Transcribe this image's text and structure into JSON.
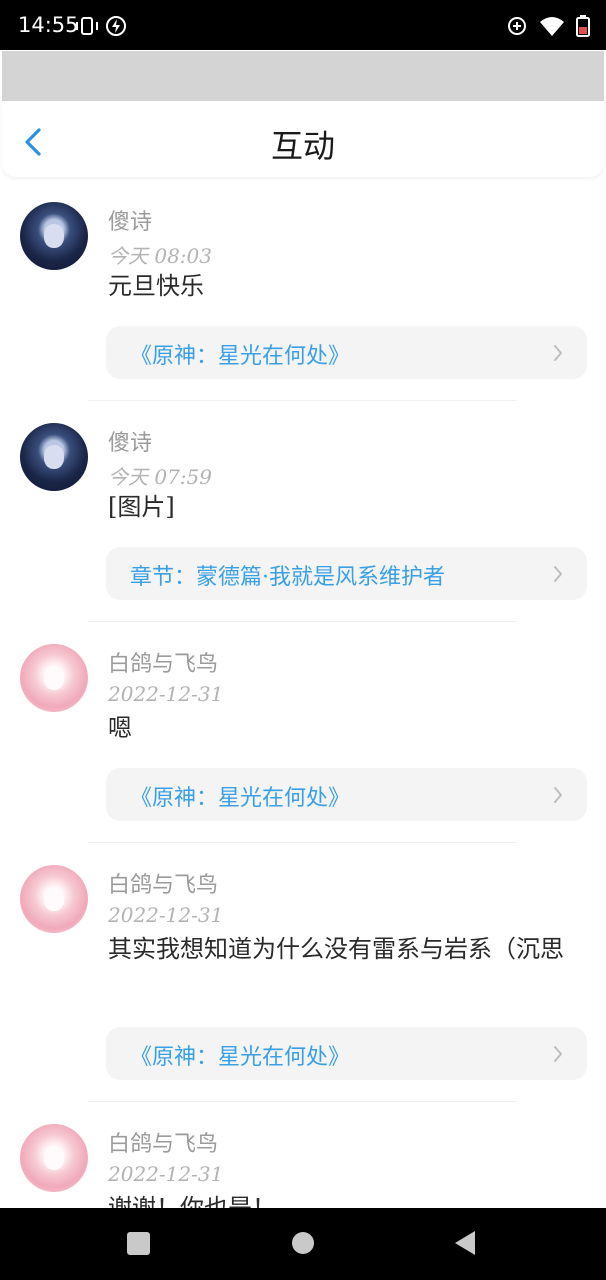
{
  "status_bar": {
    "time": "14:55"
  },
  "header": {
    "title": "互动"
  },
  "colors": {
    "accent": "#3aa0e6",
    "username": "#9b9b9b",
    "timestamp": "#b3b3b3",
    "card_bg": "#f4f4f4"
  },
  "feed": {
    "items": [
      {
        "username": "傻诗",
        "time": "今天 08:03",
        "comment": "元旦快乐",
        "source": "《原神：星光在何处》",
        "avatar": "dark-hair-avatar"
      },
      {
        "username": "傻诗",
        "time": "今天 07:59",
        "comment": "[图片]",
        "source": "章节：蒙德篇·我就是风系维护者",
        "avatar": "dark-hair-avatar"
      },
      {
        "username": "白鸽与飞鸟",
        "time": "2022-12-31",
        "comment": "嗯",
        "source": "《原神：星光在何处》",
        "avatar": "pink-hair-avatar"
      },
      {
        "username": "白鸽与飞鸟",
        "time": "2022-12-31",
        "comment": "其实我想知道为什么没有雷系与岩系（沉思",
        "source": "《原神：星光在何处》",
        "avatar": "pink-hair-avatar"
      },
      {
        "username": "白鸽与飞鸟",
        "time": "2022-12-31",
        "comment": "谢谢！你也是！",
        "source": "",
        "avatar": "pink-hair-avatar"
      }
    ]
  },
  "icons": {
    "back": "chevron-left-icon",
    "card_arrow": "chevron-right-icon",
    "nav": [
      "recents-icon",
      "home-icon",
      "back-triangle-icon"
    ]
  }
}
